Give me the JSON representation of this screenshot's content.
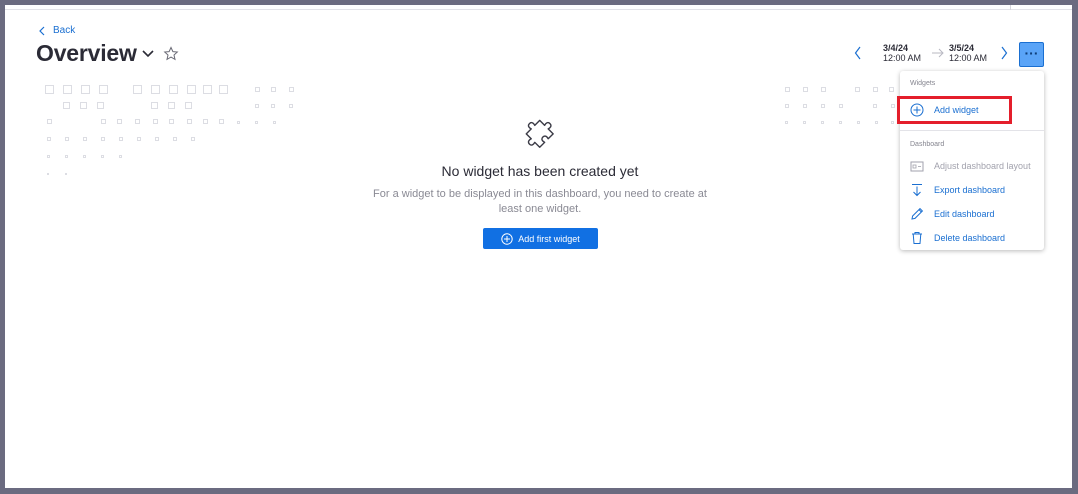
{
  "header": {
    "back_label": "Back",
    "title": "Overview"
  },
  "timeframe": {
    "from_date": "3/4/24",
    "from_time": "12:00 AM",
    "to_date": "3/5/24",
    "to_time": "12:00 AM"
  },
  "more_button": {
    "label": "···"
  },
  "menu": {
    "widgets_section": "Widgets",
    "add_widget": "Add widget",
    "dashboard_section": "Dashboard",
    "adjust_layout": "Adjust dashboard layout",
    "export": "Export dashboard",
    "edit": "Edit dashboard",
    "delete": "Delete dashboard"
  },
  "empty_state": {
    "title": "No widget has been created yet",
    "description": "For a widget to be displayed in this dashboard, you need to create at least one widget.",
    "button_label": "Add first widget"
  },
  "colors": {
    "accent": "#1170e3",
    "highlight": "#e41e2b",
    "more_button_bg": "#5aa4f7"
  },
  "icons": [
    "chevron-left-icon",
    "chevron-down-icon",
    "star-icon",
    "chevron-right-icon",
    "arrow-right-icon",
    "more-icon",
    "plus-circle-icon",
    "layout-icon",
    "export-icon",
    "pencil-icon",
    "trash-icon",
    "puzzle-icon"
  ]
}
